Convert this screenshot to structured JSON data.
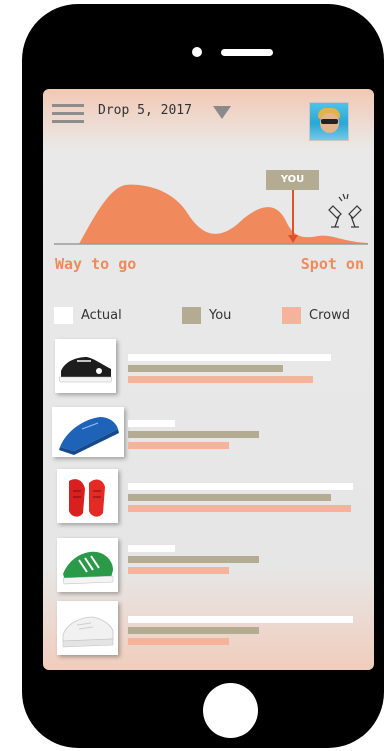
{
  "header": {
    "menu_icon": "hamburger-menu-icon",
    "drop_label": "Drop 5, 2017",
    "dropdown_icon": "triangle-down-icon",
    "avatar_icon": "user-avatar"
  },
  "gauge": {
    "you_tag": "YOU",
    "left_label": "Way to go",
    "right_label": "Spot on",
    "celebrate_icon": "champagne-glasses-icon",
    "curve_color": "#f08a5d",
    "marker_color": "#e0502a"
  },
  "legend": [
    {
      "label": "Actual",
      "color": "#ffffff"
    },
    {
      "label": "You",
      "color": "#b3ab92"
    },
    {
      "label": "Crowd",
      "color": "#f5b39b"
    }
  ],
  "products": [
    {
      "name": "black-sneaker",
      "actual": 0.9,
      "you": 0.69,
      "crowd": 0.82
    },
    {
      "name": "blue-running-shoe",
      "actual": 0.21,
      "you": 0.58,
      "crowd": 0.45
    },
    {
      "name": "red-running-shoe",
      "actual": 1.0,
      "you": 0.9,
      "crowd": 0.99
    },
    {
      "name": "green-adidas-shoe",
      "actual": 0.21,
      "you": 0.58,
      "crowd": 0.45
    },
    {
      "name": "white-sneaker",
      "actual": 1.0,
      "you": 0.58,
      "crowd": 0.45
    }
  ]
}
